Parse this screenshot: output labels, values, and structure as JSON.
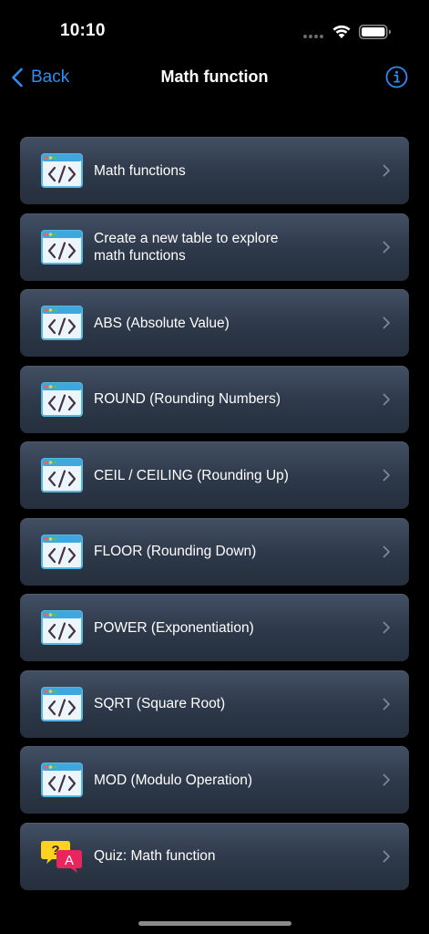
{
  "status_bar": {
    "time": "10:10"
  },
  "nav": {
    "back_label": "Back",
    "title": "Math function",
    "accent_color": "#2f8cf5"
  },
  "rows": [
    {
      "label": "Math functions",
      "icon": "code-window-icon"
    },
    {
      "label": "Create a new table to explore\nmath functions",
      "icon": "code-window-icon"
    },
    {
      "label": "ABS (Absolute Value)",
      "icon": "code-window-icon"
    },
    {
      "label": "ROUND (Rounding Numbers)",
      "icon": "code-window-icon"
    },
    {
      "label": "CEIL / CEILING (Rounding Up)",
      "icon": "code-window-icon"
    },
    {
      "label": "FLOOR (Rounding Down)",
      "icon": "code-window-icon"
    },
    {
      "label": "POWER (Exponentiation)",
      "icon": "code-window-icon"
    },
    {
      "label": "SQRT (Square Root)",
      "icon": "code-window-icon"
    },
    {
      "label": "MOD (Modulo Operation)",
      "icon": "code-window-icon"
    },
    {
      "label": "Quiz: Math function",
      "icon": "quiz-icon"
    }
  ]
}
